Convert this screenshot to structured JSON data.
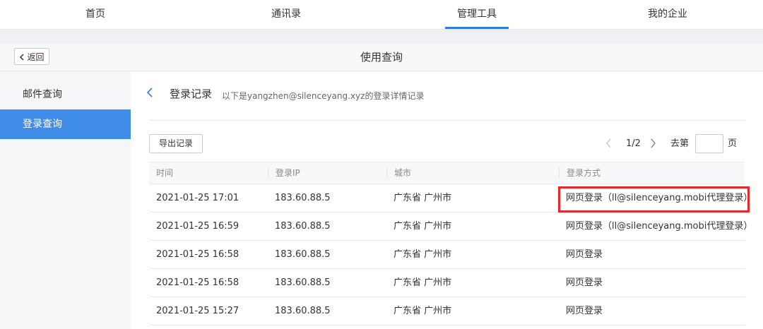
{
  "nav": {
    "items": [
      {
        "label": "首页"
      },
      {
        "label": "通讯录"
      },
      {
        "label": "管理工具"
      },
      {
        "label": "我的企业"
      }
    ],
    "active_index": 2,
    "accent_color": "#2e7de6"
  },
  "header": {
    "back_label": "返回",
    "title": "使用查询"
  },
  "sidebar": {
    "items": [
      {
        "label": "邮件查询"
      },
      {
        "label": "登录查询"
      }
    ],
    "active_index": 1,
    "active_color": "#3f8de8"
  },
  "section": {
    "title": "登录记录",
    "subtitle": "以下是yangzhen@silenceyang.xyz的登录详情记录"
  },
  "toolbar": {
    "export_label": "导出记录"
  },
  "pagination": {
    "page_indicator": "1/2",
    "goto_label": "去第",
    "page_unit": "页",
    "page_input_value": ""
  },
  "table": {
    "columns": [
      "时间",
      "登录IP",
      "城市",
      "登录方式"
    ],
    "rows": [
      [
        "2021-01-25 17:01",
        "183.60.88.5",
        "广东省 广州市",
        "网页登录（ll@silenceyang.mobi代理登录）"
      ],
      [
        "2021-01-25 16:59",
        "183.60.88.5",
        "广东省 广州市",
        "网页登录（ll@silenceyang.mobi代理登录）"
      ],
      [
        "2021-01-25 16:58",
        "183.60.88.5",
        "广东省 广州市",
        "网页登录"
      ],
      [
        "2021-01-25 16:58",
        "183.60.88.5",
        "广东省 广州市",
        "网页登录"
      ],
      [
        "2021-01-25 15:27",
        "183.60.88.5",
        "广东省 广州市",
        "网页登录"
      ]
    ],
    "highlight_color": "#e8262b"
  }
}
